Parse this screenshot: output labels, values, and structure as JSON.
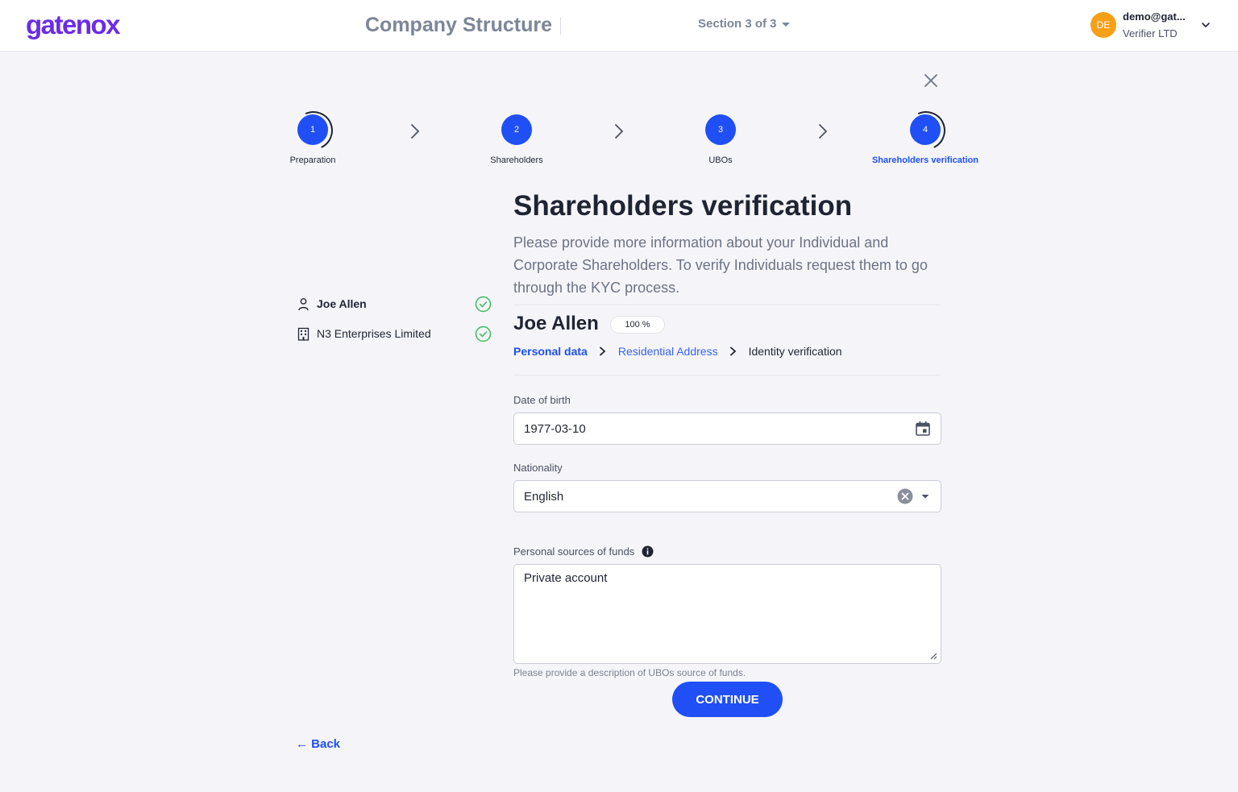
{
  "header": {
    "logo": "gatenox",
    "title": "Company Structure",
    "section": "Section 3 of 3",
    "user": {
      "initials": "DE",
      "email": "demo@gat...",
      "org": "Verifier LTD"
    }
  },
  "stepper": {
    "steps": [
      {
        "number": "1",
        "label": "Preparation"
      },
      {
        "number": "2",
        "label": "Shareholders"
      },
      {
        "number": "3",
        "label": "UBOs"
      },
      {
        "number": "4",
        "label": "Shareholders verification"
      }
    ],
    "active_step": 4
  },
  "sidebar": {
    "items": [
      {
        "label": "Joe Allen",
        "icon": "person-icon",
        "status": "completed"
      },
      {
        "label": "N3 Enterprises Limited",
        "icon": "building-icon",
        "status": "completed"
      }
    ]
  },
  "main": {
    "heading": "Shareholders verification",
    "intro": "Please provide more information about your Individual and Corporate Shareholders. To verify Individuals request them to go through the KYC process.",
    "person_name": "Joe Allen",
    "progress": "100 %",
    "subnav": [
      "Personal data",
      "Residential Address",
      "Identity verification"
    ],
    "form": {
      "dob_label": "Date of birth",
      "dob_value": "1977-03-10",
      "nationality_label": "Nationality",
      "nationality_value": "English",
      "funds_label": "Personal sources of funds",
      "funds_value": "Private account",
      "funds_hint": "Please provide a description of UBOs source of funds."
    },
    "continue_label": "CONTINUE",
    "back_label": "← Back"
  },
  "colors": {
    "accent": "#1f4ff5",
    "brand": "#6a2ce8",
    "success": "#3cba5a",
    "avatar": "#f6a018"
  }
}
